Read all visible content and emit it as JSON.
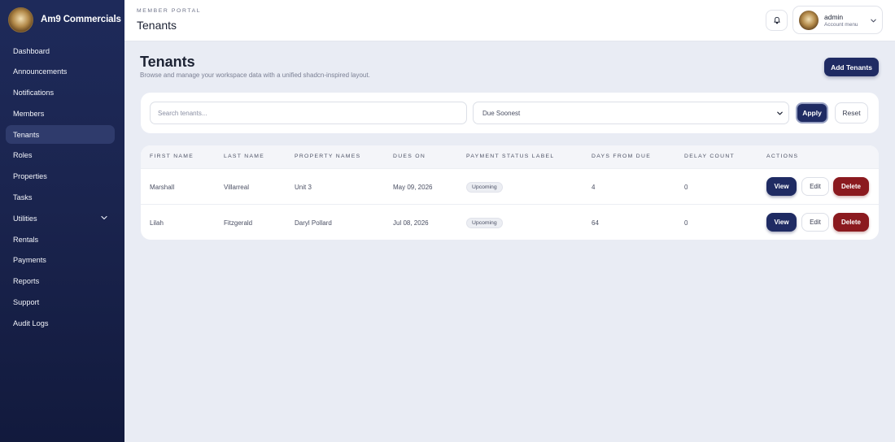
{
  "brand": {
    "name": "Am9 Commercials"
  },
  "sidebar": {
    "items": [
      {
        "label": "Dashboard"
      },
      {
        "label": "Announcements"
      },
      {
        "label": "Notifications"
      },
      {
        "label": "Members"
      },
      {
        "label": "Tenants",
        "active": true
      },
      {
        "label": "Roles"
      },
      {
        "label": "Properties"
      },
      {
        "label": "Tasks"
      },
      {
        "label": "Utilities",
        "expandable": true
      },
      {
        "label": "Rentals"
      },
      {
        "label": "Payments"
      },
      {
        "label": "Reports"
      },
      {
        "label": "Support"
      },
      {
        "label": "Audit Logs"
      }
    ]
  },
  "header": {
    "eyebrow": "MEMBER PORTAL",
    "title": "Tenants",
    "account": {
      "name": "admin",
      "subtitle": "Account menu"
    }
  },
  "main": {
    "title": "Tenants",
    "subtitle": "Browse and manage your workspace data with a unified shadcn-inspired layout.",
    "add_label": "Add Tenants"
  },
  "filters": {
    "search_placeholder": "Search tenants...",
    "search_value": "",
    "sort_value": "Due Soonest",
    "apply_label": "Apply",
    "reset_label": "Reset"
  },
  "table": {
    "columns": [
      "FIRST NAME",
      "LAST NAME",
      "PROPERTY NAMES",
      "DUES ON",
      "PAYMENT STATUS LABEL",
      "DAYS FROM DUE",
      "DELAY COUNT",
      "ACTIONS"
    ],
    "rows": [
      {
        "first": "Marshall",
        "last": "Villarreal",
        "property": "Unit 3",
        "due": "May 09, 2026",
        "status": "Upcoming",
        "days": "4",
        "delay": "0"
      },
      {
        "first": "Lilah",
        "last": "Fitzgerald",
        "property": "Daryl Pollard",
        "due": "Jul 08, 2026",
        "status": "Upcoming",
        "days": "64",
        "delay": "0"
      }
    ],
    "actions": {
      "view": "View",
      "edit": "Edit",
      "delete": "Delete"
    }
  },
  "colors": {
    "sidebar_bg": "#1b2550",
    "primary": "#1f2b63",
    "danger": "#8b1a1f",
    "page_bg": "#e9ecf4"
  }
}
